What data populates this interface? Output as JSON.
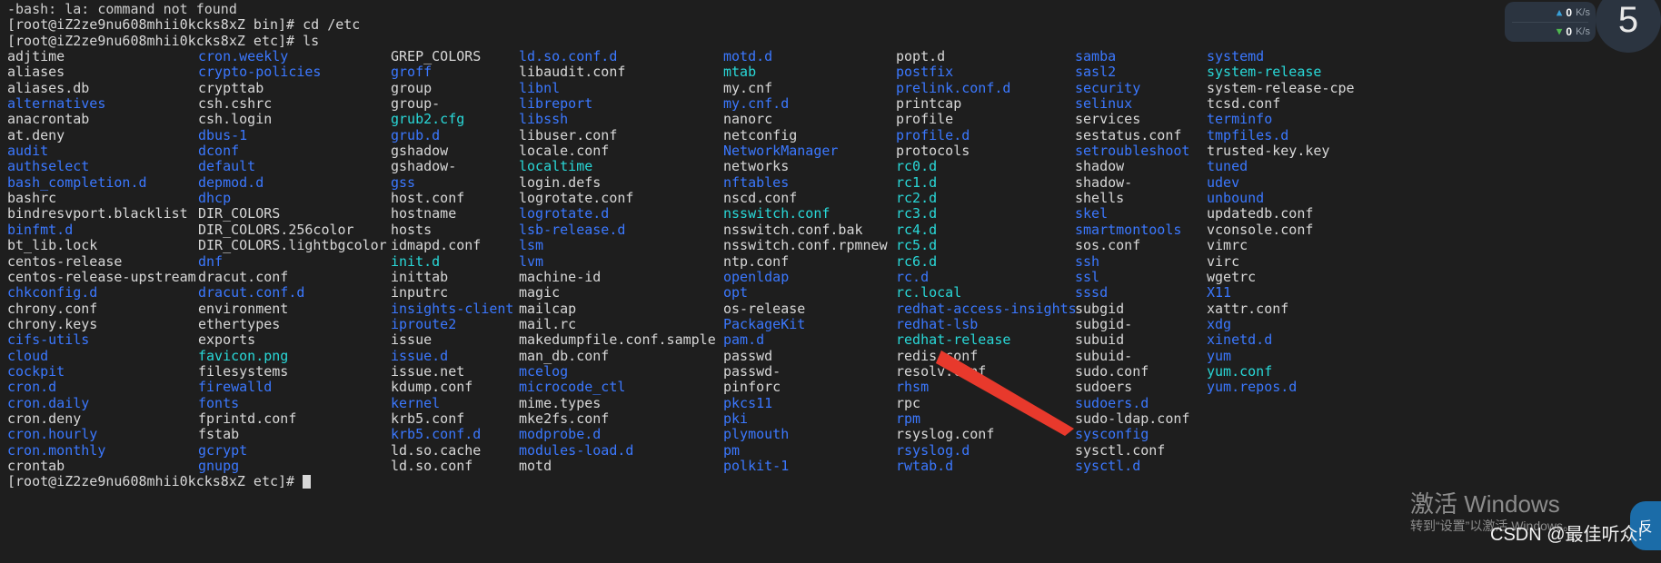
{
  "terminal": {
    "error_line": "-bash: la: command not found",
    "prompt_line_1": "[root@iZ2ze9nu608mhii0kcks8xZ bin]# cd /etc",
    "prompt_line_2": "[root@iZ2ze9nu608mhii0kcks8xZ etc]# ls",
    "prompt_line_3": "[root@iZ2ze9nu608mhii0kcks8xZ etc]# ",
    "background": "#1e1e1e",
    "file_color": "#d8d8d8",
    "dir_color": "#3b78ff",
    "link_color": "#29d8d8"
  },
  "listing": {
    "columns": [
      [
        {
          "n": "adjtime",
          "t": "file"
        },
        {
          "n": "aliases",
          "t": "file"
        },
        {
          "n": "aliases.db",
          "t": "file"
        },
        {
          "n": "alternatives",
          "t": "dir"
        },
        {
          "n": "anacrontab",
          "t": "file"
        },
        {
          "n": "at.deny",
          "t": "file"
        },
        {
          "n": "audit",
          "t": "dir"
        },
        {
          "n": "authselect",
          "t": "dir"
        },
        {
          "n": "bash_completion.d",
          "t": "dir"
        },
        {
          "n": "bashrc",
          "t": "file"
        },
        {
          "n": "bindresvport.blacklist",
          "t": "file"
        },
        {
          "n": "binfmt.d",
          "t": "dir"
        },
        {
          "n": "bt_lib.lock",
          "t": "file"
        },
        {
          "n": "centos-release",
          "t": "file"
        },
        {
          "n": "centos-release-upstream",
          "t": "file"
        },
        {
          "n": "chkconfig.d",
          "t": "dir"
        },
        {
          "n": "chrony.conf",
          "t": "file"
        },
        {
          "n": "chrony.keys",
          "t": "file"
        },
        {
          "n": "cifs-utils",
          "t": "dir"
        },
        {
          "n": "cloud",
          "t": "dir"
        },
        {
          "n": "cockpit",
          "t": "dir"
        },
        {
          "n": "cron.d",
          "t": "dir"
        },
        {
          "n": "cron.daily",
          "t": "dir"
        },
        {
          "n": "cron.deny",
          "t": "file"
        },
        {
          "n": "cron.hourly",
          "t": "dir"
        },
        {
          "n": "cron.monthly",
          "t": "dir"
        },
        {
          "n": "crontab",
          "t": "file"
        }
      ],
      [
        {
          "n": "cron.weekly",
          "t": "dir"
        },
        {
          "n": "crypto-policies",
          "t": "dir"
        },
        {
          "n": "crypttab",
          "t": "file"
        },
        {
          "n": "csh.cshrc",
          "t": "file"
        },
        {
          "n": "csh.login",
          "t": "file"
        },
        {
          "n": "dbus-1",
          "t": "dir"
        },
        {
          "n": "dconf",
          "t": "dir"
        },
        {
          "n": "default",
          "t": "dir"
        },
        {
          "n": "depmod.d",
          "t": "dir"
        },
        {
          "n": "dhcp",
          "t": "dir"
        },
        {
          "n": "DIR_COLORS",
          "t": "file"
        },
        {
          "n": "DIR_COLORS.256color",
          "t": "file"
        },
        {
          "n": "DIR_COLORS.lightbgcolor",
          "t": "file"
        },
        {
          "n": "dnf",
          "t": "dir"
        },
        {
          "n": "dracut.conf",
          "t": "file"
        },
        {
          "n": "dracut.conf.d",
          "t": "dir"
        },
        {
          "n": "environment",
          "t": "file"
        },
        {
          "n": "ethertypes",
          "t": "file"
        },
        {
          "n": "exports",
          "t": "file"
        },
        {
          "n": "favicon.png",
          "t": "link"
        },
        {
          "n": "filesystems",
          "t": "file"
        },
        {
          "n": "firewalld",
          "t": "dir"
        },
        {
          "n": "fonts",
          "t": "dir"
        },
        {
          "n": "fprintd.conf",
          "t": "file"
        },
        {
          "n": "fstab",
          "t": "file"
        },
        {
          "n": "gcrypt",
          "t": "dir"
        },
        {
          "n": "gnupg",
          "t": "dir"
        }
      ],
      [
        {
          "n": "GREP_COLORS",
          "t": "file"
        },
        {
          "n": "groff",
          "t": "dir"
        },
        {
          "n": "group",
          "t": "file"
        },
        {
          "n": "group-",
          "t": "file"
        },
        {
          "n": "grub2.cfg",
          "t": "link"
        },
        {
          "n": "grub.d",
          "t": "dir"
        },
        {
          "n": "gshadow",
          "t": "file"
        },
        {
          "n": "gshadow-",
          "t": "file"
        },
        {
          "n": "gss",
          "t": "dir"
        },
        {
          "n": "host.conf",
          "t": "file"
        },
        {
          "n": "hostname",
          "t": "file"
        },
        {
          "n": "hosts",
          "t": "file"
        },
        {
          "n": "idmapd.conf",
          "t": "file"
        },
        {
          "n": "init.d",
          "t": "link"
        },
        {
          "n": "inittab",
          "t": "file"
        },
        {
          "n": "inputrc",
          "t": "file"
        },
        {
          "n": "insights-client",
          "t": "dir"
        },
        {
          "n": "iproute2",
          "t": "dir"
        },
        {
          "n": "issue",
          "t": "file"
        },
        {
          "n": "issue.d",
          "t": "dir"
        },
        {
          "n": "issue.net",
          "t": "file"
        },
        {
          "n": "kdump.conf",
          "t": "file"
        },
        {
          "n": "kernel",
          "t": "dir"
        },
        {
          "n": "krb5.conf",
          "t": "file"
        },
        {
          "n": "krb5.conf.d",
          "t": "dir"
        },
        {
          "n": "ld.so.cache",
          "t": "file"
        },
        {
          "n": "ld.so.conf",
          "t": "file"
        }
      ],
      [
        {
          "n": "ld.so.conf.d",
          "t": "dir"
        },
        {
          "n": "libaudit.conf",
          "t": "file"
        },
        {
          "n": "libnl",
          "t": "dir"
        },
        {
          "n": "libreport",
          "t": "dir"
        },
        {
          "n": "libssh",
          "t": "dir"
        },
        {
          "n": "libuser.conf",
          "t": "file"
        },
        {
          "n": "locale.conf",
          "t": "file"
        },
        {
          "n": "localtime",
          "t": "link"
        },
        {
          "n": "login.defs",
          "t": "file"
        },
        {
          "n": "logrotate.conf",
          "t": "file"
        },
        {
          "n": "logrotate.d",
          "t": "dir"
        },
        {
          "n": "lsb-release.d",
          "t": "dir"
        },
        {
          "n": "lsm",
          "t": "dir"
        },
        {
          "n": "lvm",
          "t": "dir"
        },
        {
          "n": "machine-id",
          "t": "file"
        },
        {
          "n": "magic",
          "t": "file"
        },
        {
          "n": "mailcap",
          "t": "file"
        },
        {
          "n": "mail.rc",
          "t": "file"
        },
        {
          "n": "makedumpfile.conf.sample",
          "t": "file"
        },
        {
          "n": "man_db.conf",
          "t": "file"
        },
        {
          "n": "mcelog",
          "t": "dir"
        },
        {
          "n": "microcode_ctl",
          "t": "dir"
        },
        {
          "n": "mime.types",
          "t": "file"
        },
        {
          "n": "mke2fs.conf",
          "t": "file"
        },
        {
          "n": "modprobe.d",
          "t": "dir"
        },
        {
          "n": "modules-load.d",
          "t": "dir"
        },
        {
          "n": "motd",
          "t": "file"
        }
      ],
      [
        {
          "n": "motd.d",
          "t": "dir"
        },
        {
          "n": "mtab",
          "t": "link"
        },
        {
          "n": "my.cnf",
          "t": "file"
        },
        {
          "n": "my.cnf.d",
          "t": "dir"
        },
        {
          "n": "nanorc",
          "t": "file"
        },
        {
          "n": "netconfig",
          "t": "file"
        },
        {
          "n": "NetworkManager",
          "t": "dir"
        },
        {
          "n": "networks",
          "t": "file"
        },
        {
          "n": "nftables",
          "t": "dir"
        },
        {
          "n": "nscd.conf",
          "t": "file"
        },
        {
          "n": "nsswitch.conf",
          "t": "link"
        },
        {
          "n": "nsswitch.conf.bak",
          "t": "file"
        },
        {
          "n": "nsswitch.conf.rpmnew",
          "t": "file"
        },
        {
          "n": "ntp.conf",
          "t": "file"
        },
        {
          "n": "openldap",
          "t": "dir"
        },
        {
          "n": "opt",
          "t": "dir"
        },
        {
          "n": "os-release",
          "t": "file"
        },
        {
          "n": "PackageKit",
          "t": "dir"
        },
        {
          "n": "pam.d",
          "t": "dir"
        },
        {
          "n": "passwd",
          "t": "file"
        },
        {
          "n": "passwd-",
          "t": "file"
        },
        {
          "n": "pinforc",
          "t": "file"
        },
        {
          "n": "pkcs11",
          "t": "dir"
        },
        {
          "n": "pki",
          "t": "dir"
        },
        {
          "n": "plymouth",
          "t": "dir"
        },
        {
          "n": "pm",
          "t": "dir"
        },
        {
          "n": "polkit-1",
          "t": "dir"
        }
      ],
      [
        {
          "n": "popt.d",
          "t": "file"
        },
        {
          "n": "postfix",
          "t": "dir"
        },
        {
          "n": "prelink.conf.d",
          "t": "dir"
        },
        {
          "n": "printcap",
          "t": "file"
        },
        {
          "n": "profile",
          "t": "file"
        },
        {
          "n": "profile.d",
          "t": "dir"
        },
        {
          "n": "protocols",
          "t": "file"
        },
        {
          "n": "rc0.d",
          "t": "link"
        },
        {
          "n": "rc1.d",
          "t": "link"
        },
        {
          "n": "rc2.d",
          "t": "link"
        },
        {
          "n": "rc3.d",
          "t": "link"
        },
        {
          "n": "rc4.d",
          "t": "link"
        },
        {
          "n": "rc5.d",
          "t": "link"
        },
        {
          "n": "rc6.d",
          "t": "link"
        },
        {
          "n": "rc.d",
          "t": "dir"
        },
        {
          "n": "rc.local",
          "t": "link"
        },
        {
          "n": "redhat-access-insights",
          "t": "dir"
        },
        {
          "n": "redhat-lsb",
          "t": "dir"
        },
        {
          "n": "redhat-release",
          "t": "link"
        },
        {
          "n": "redis.conf",
          "t": "file"
        },
        {
          "n": "resolv.conf",
          "t": "file"
        },
        {
          "n": "rhsm",
          "t": "dir"
        },
        {
          "n": "rpc",
          "t": "file"
        },
        {
          "n": "rpm",
          "t": "dir"
        },
        {
          "n": "rsyslog.conf",
          "t": "file"
        },
        {
          "n": "rsyslog.d",
          "t": "dir"
        },
        {
          "n": "rwtab.d",
          "t": "dir"
        }
      ],
      [
        {
          "n": "samba",
          "t": "dir"
        },
        {
          "n": "sasl2",
          "t": "dir"
        },
        {
          "n": "security",
          "t": "dir"
        },
        {
          "n": "selinux",
          "t": "dir"
        },
        {
          "n": "services",
          "t": "file"
        },
        {
          "n": "sestatus.conf",
          "t": "file"
        },
        {
          "n": "setroubleshoot",
          "t": "dir"
        },
        {
          "n": "shadow",
          "t": "file"
        },
        {
          "n": "shadow-",
          "t": "file"
        },
        {
          "n": "shells",
          "t": "file"
        },
        {
          "n": "skel",
          "t": "dir"
        },
        {
          "n": "smartmontools",
          "t": "dir"
        },
        {
          "n": "sos.conf",
          "t": "file"
        },
        {
          "n": "ssh",
          "t": "dir"
        },
        {
          "n": "ssl",
          "t": "dir"
        },
        {
          "n": "sssd",
          "t": "dir"
        },
        {
          "n": "subgid",
          "t": "file"
        },
        {
          "n": "subgid-",
          "t": "file"
        },
        {
          "n": "subuid",
          "t": "file"
        },
        {
          "n": "subuid-",
          "t": "file"
        },
        {
          "n": "sudo.conf",
          "t": "file"
        },
        {
          "n": "sudoers",
          "t": "file"
        },
        {
          "n": "sudoers.d",
          "t": "dir"
        },
        {
          "n": "sudo-ldap.conf",
          "t": "file"
        },
        {
          "n": "sysconfig",
          "t": "dir"
        },
        {
          "n": "sysctl.conf",
          "t": "file"
        },
        {
          "n": "sysctl.d",
          "t": "dir"
        }
      ],
      [
        {
          "n": "systemd",
          "t": "dir"
        },
        {
          "n": "system-release",
          "t": "link"
        },
        {
          "n": "system-release-cpe",
          "t": "file"
        },
        {
          "n": "tcsd.conf",
          "t": "file"
        },
        {
          "n": "terminfo",
          "t": "dir"
        },
        {
          "n": "tmpfiles.d",
          "t": "dir"
        },
        {
          "n": "trusted-key.key",
          "t": "file"
        },
        {
          "n": "tuned",
          "t": "dir"
        },
        {
          "n": "udev",
          "t": "dir"
        },
        {
          "n": "unbound",
          "t": "dir"
        },
        {
          "n": "updatedb.conf",
          "t": "file"
        },
        {
          "n": "vconsole.conf",
          "t": "file"
        },
        {
          "n": "vimrc",
          "t": "file"
        },
        {
          "n": "virc",
          "t": "file"
        },
        {
          "n": "wgetrc",
          "t": "file"
        },
        {
          "n": "X11",
          "t": "dir"
        },
        {
          "n": "xattr.conf",
          "t": "file"
        },
        {
          "n": "xdg",
          "t": "dir"
        },
        {
          "n": "xinetd.d",
          "t": "dir"
        },
        {
          "n": "yum",
          "t": "dir"
        },
        {
          "n": "yum.conf",
          "t": "link"
        },
        {
          "n": "yum.repos.d",
          "t": "dir"
        }
      ]
    ]
  },
  "annotation": {
    "arrow_color": "#e8392c",
    "points_at": "redis.conf"
  },
  "net_widget": {
    "upload_value": "0",
    "upload_unit": "K/s",
    "download_value": "0",
    "download_unit": "K/s",
    "badge_value": "5",
    "side_tab_label": "反"
  },
  "watermark": {
    "line1": "激活 Windows",
    "line2": "转到“设置”以激活 Windows。",
    "credit": "CSDN @最佳听众!"
  }
}
